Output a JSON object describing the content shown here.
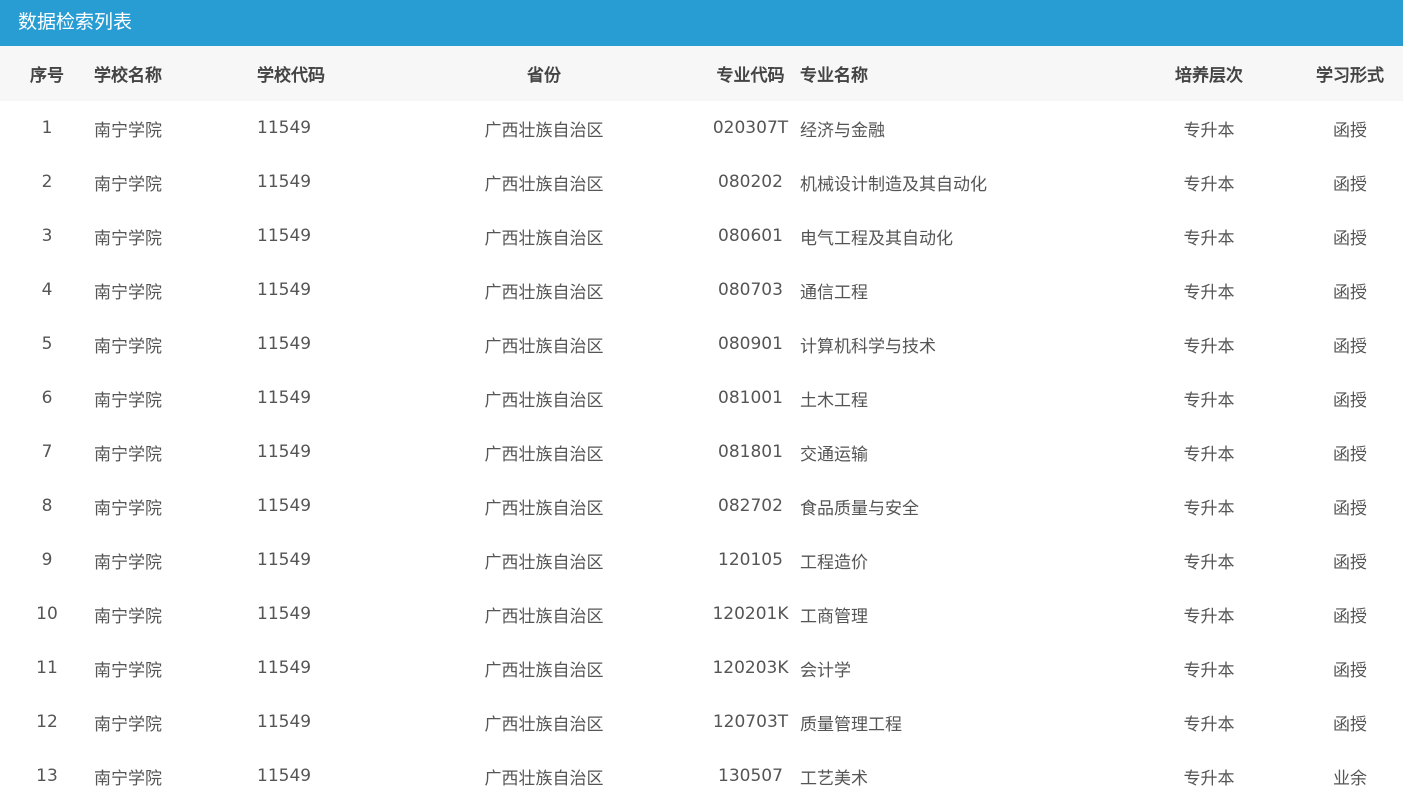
{
  "title": "数据检索列表",
  "columns": [
    "序号",
    "学校名称",
    "学校代码",
    "省份",
    "专业代码",
    "专业名称",
    "培养层次",
    "学习形式"
  ],
  "rows": [
    [
      "1",
      "南宁学院",
      "11549",
      "广西壮族自治区",
      "020307T",
      "经济与金融",
      "专升本",
      "函授"
    ],
    [
      "2",
      "南宁学院",
      "11549",
      "广西壮族自治区",
      "080202",
      "机械设计制造及其自动化",
      "专升本",
      "函授"
    ],
    [
      "3",
      "南宁学院",
      "11549",
      "广西壮族自治区",
      "080601",
      "电气工程及其自动化",
      "专升本",
      "函授"
    ],
    [
      "4",
      "南宁学院",
      "11549",
      "广西壮族自治区",
      "080703",
      "通信工程",
      "专升本",
      "函授"
    ],
    [
      "5",
      "南宁学院",
      "11549",
      "广西壮族自治区",
      "080901",
      "计算机科学与技术",
      "专升本",
      "函授"
    ],
    [
      "6",
      "南宁学院",
      "11549",
      "广西壮族自治区",
      "081001",
      "土木工程",
      "专升本",
      "函授"
    ],
    [
      "7",
      "南宁学院",
      "11549",
      "广西壮族自治区",
      "081801",
      "交通运输",
      "专升本",
      "函授"
    ],
    [
      "8",
      "南宁学院",
      "11549",
      "广西壮族自治区",
      "082702",
      "食品质量与安全",
      "专升本",
      "函授"
    ],
    [
      "9",
      "南宁学院",
      "11549",
      "广西壮族自治区",
      "120105",
      "工程造价",
      "专升本",
      "函授"
    ],
    [
      "10",
      "南宁学院",
      "11549",
      "广西壮族自治区",
      "120201K",
      "工商管理",
      "专升本",
      "函授"
    ],
    [
      "11",
      "南宁学院",
      "11549",
      "广西壮族自治区",
      "120203K",
      "会计学",
      "专升本",
      "函授"
    ],
    [
      "12",
      "南宁学院",
      "11549",
      "广西壮族自治区",
      "120703T",
      "质量管理工程",
      "专升本",
      "函授"
    ],
    [
      "13",
      "南宁学院",
      "11549",
      "广西壮族自治区",
      "130507",
      "工艺美术",
      "专升本",
      "业余"
    ]
  ]
}
